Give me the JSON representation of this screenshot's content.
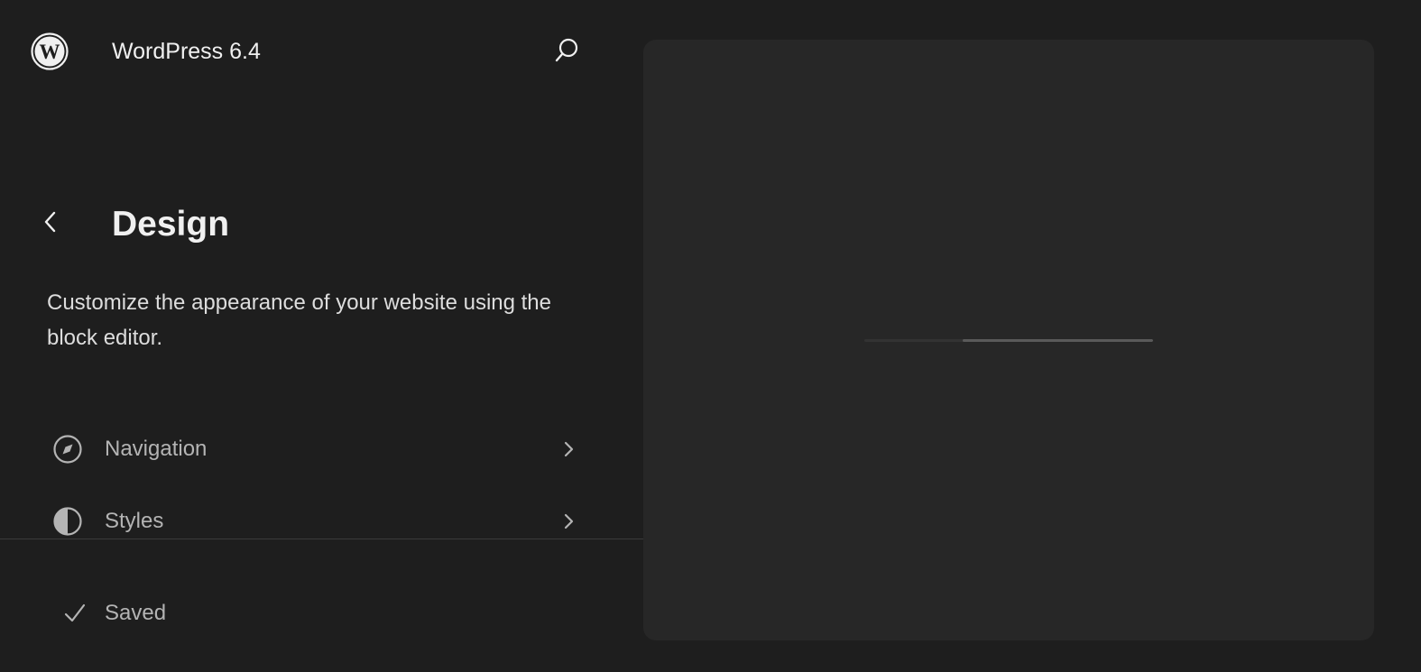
{
  "header": {
    "site_title": "WordPress 6.4",
    "logo_icon": "wordpress-logo-icon",
    "search_icon": "search-icon"
  },
  "panel": {
    "back_icon": "chevron-left-icon",
    "title": "Design",
    "description": "Customize the appearance of your website using the block editor."
  },
  "nav": {
    "items": [
      {
        "label": "Navigation",
        "icon": "navigation-compass-icon",
        "chevron": "chevron-right-icon"
      },
      {
        "label": "Styles",
        "icon": "styles-half-circle-icon",
        "chevron": "chevron-right-icon"
      }
    ]
  },
  "footer": {
    "status_icon": "check-icon",
    "status_label": "Saved"
  },
  "canvas": {
    "loading_progress": {
      "start": 0.34,
      "end": 1.0
    }
  },
  "colors": {
    "background": "#1e1e1e",
    "canvas": "#272727",
    "text_primary": "#f0f0f0",
    "text_secondary": "#b4b4b4"
  }
}
